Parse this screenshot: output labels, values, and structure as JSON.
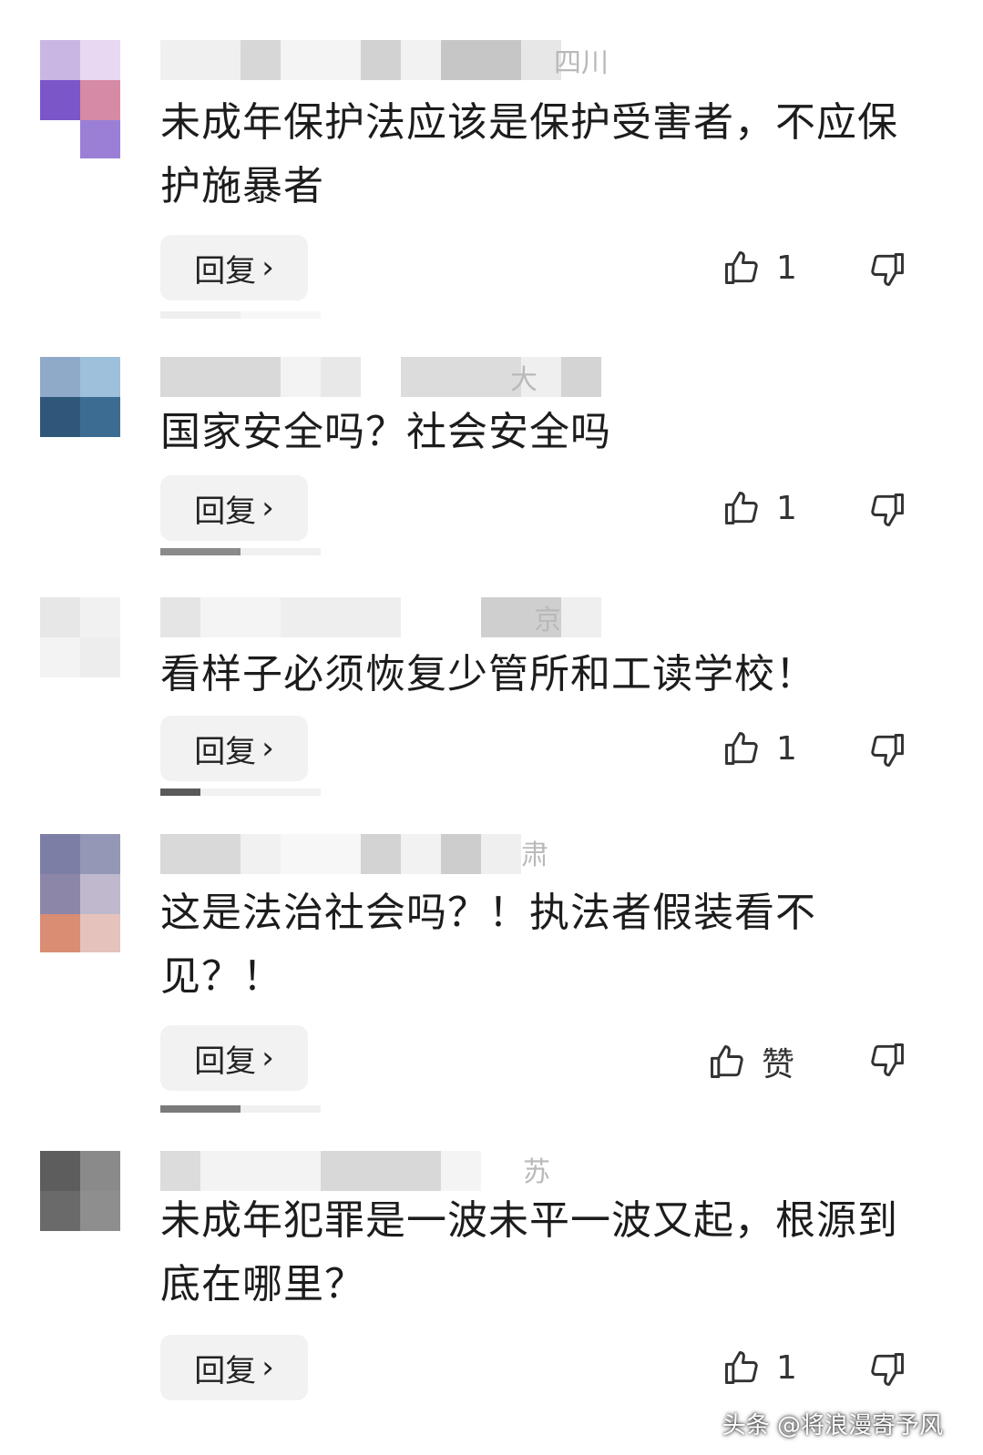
{
  "comments": [
    {
      "location": "四川",
      "text": "未成年保护法应该是保护受害者，不应保护施暴者",
      "reply": "回复",
      "likes": "1",
      "avatar_colors": [
        "#c9b6e3",
        "#e9d8f2",
        "#7a56c9",
        "#d68aa5",
        "#9b7fd6",
        "#ffffff"
      ]
    },
    {
      "location": "大",
      "text": "国家安全吗？社会安全吗",
      "reply": "回复",
      "likes": "1",
      "avatar_colors": [
        "#8fa9c9",
        "#9ec0da",
        "#2f5779",
        "#3d6c92",
        "#ffffff",
        "#ffffff"
      ]
    },
    {
      "location": "京",
      "text": "看样子必须恢复少管所和工读学校！",
      "reply": "回复",
      "likes": "1",
      "avatar_colors": [
        "#e7e7e7",
        "#f1f1f1",
        "#f3f3f3",
        "#ededed",
        "#ffffff",
        "#ffffff"
      ]
    },
    {
      "location": "肃",
      "text": "这是法治社会吗？！执法者假装看不见？！",
      "reply": "回复",
      "likes": "赞",
      "avatar_colors": [
        "#7d7ea6",
        "#9597b6",
        "#8c86a9",
        "#c0b9cd",
        "#d98d73",
        "#e5c2bb"
      ]
    },
    {
      "location": "苏",
      "text": "未成年犯罪是一波未平一波又起，根源到底在哪里？",
      "reply": "回复",
      "likes": "1",
      "avatar_colors": [
        "#5d5d5d",
        "#8a8a8a",
        "#6a6a6a",
        "#8e8e8e",
        "#ffffff",
        "#ffffff"
      ]
    }
  ],
  "watermark": "头条 @将浪漫寄予风"
}
